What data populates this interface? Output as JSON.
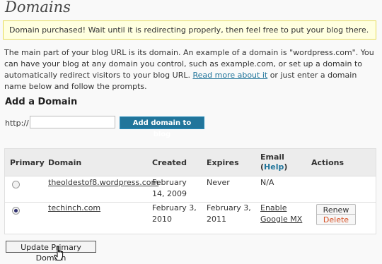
{
  "page": {
    "title": "Domains"
  },
  "notice": {
    "text": "Domain purchased! Wait until it is redirecting properly, then feel free to put your blog there."
  },
  "intro": {
    "text_before": "The main part of your blog URL is its domain. An example of a domain is \"wordpress.com\". You can have your blog at any domain you control, such as example.com, or set up a domain to automatically redirect visitors to your blog URL. ",
    "link": "Read more about it",
    "text_after": " or just enter a domain name below and follow the prompts."
  },
  "add_domain": {
    "heading": "Add a Domain",
    "prefix": "http://",
    "input_value": "",
    "button": "Add domain to blog"
  },
  "table": {
    "headers": {
      "primary": "Primary",
      "domain": "Domain",
      "created": "Created",
      "expires": "Expires",
      "email": "Email",
      "help_open": "(",
      "help": "Help",
      "help_close": ")",
      "actions": "Actions"
    },
    "rows": [
      {
        "primary": false,
        "domain": "theoldestof8.wordpress.com",
        "created": "February 14, 2009",
        "expires": "Never",
        "email": "N/A"
      },
      {
        "primary": true,
        "domain": "techinch.com",
        "created": "February 3, 2010",
        "expires": "February 3, 2011",
        "email": "Enable Google MX",
        "renew": "Renew",
        "delete": "Delete"
      }
    ]
  },
  "footer": {
    "update_button": "Update Primary Domain"
  },
  "colors": {
    "link": "#21759b",
    "notice_bg": "#ffffe0",
    "notice_border": "#e6db55",
    "delete": "#d54e21",
    "button": "#21759b"
  },
  "icons": {
    "cursor": "hand-pointer-cursor-icon"
  }
}
